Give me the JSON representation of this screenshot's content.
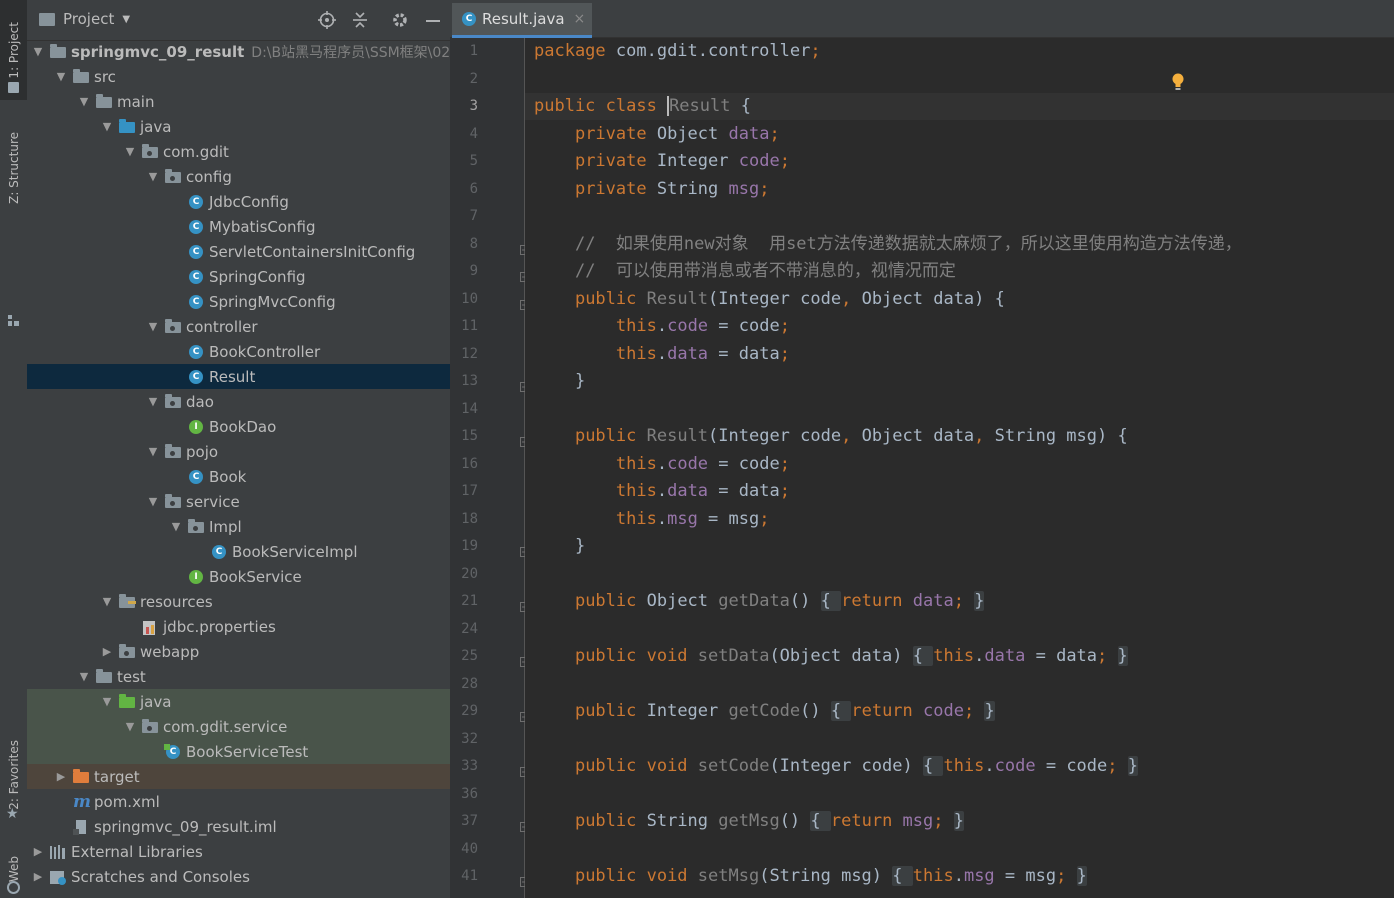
{
  "toolstrip": {
    "project_tab": "1: Project",
    "structure_tab": "Z: Structure",
    "favorites_tab": "2: Favorites",
    "web_tab": "Web"
  },
  "project_panel": {
    "title": "Project",
    "icons": [
      "locate-icon",
      "collapse-all-icon",
      "gear-icon",
      "minimize-icon"
    ],
    "tree": [
      {
        "label": "springmvc_09_result",
        "path": "D:\\B站黑马程序员\\SSM框架\\02",
        "icon": "module-folder",
        "expanded": true,
        "depth": 0,
        "bold": true
      },
      {
        "label": "src",
        "icon": "folder",
        "expanded": true,
        "depth": 1
      },
      {
        "label": "main",
        "icon": "folder",
        "expanded": true,
        "depth": 2
      },
      {
        "label": "java",
        "icon": "source-folder",
        "expanded": true,
        "depth": 3
      },
      {
        "label": "com.gdit",
        "icon": "package",
        "expanded": true,
        "depth": 4
      },
      {
        "label": "config",
        "icon": "package",
        "expanded": true,
        "depth": 5
      },
      {
        "label": "JdbcConfig",
        "icon": "class",
        "depth": 6
      },
      {
        "label": "MybatisConfig",
        "icon": "class",
        "depth": 6
      },
      {
        "label": "ServletContainersInitConfig",
        "icon": "class",
        "depth": 6
      },
      {
        "label": "SpringConfig",
        "icon": "class",
        "depth": 6
      },
      {
        "label": "SpringMvcConfig",
        "icon": "class",
        "depth": 6
      },
      {
        "label": "controller",
        "icon": "package",
        "expanded": true,
        "depth": 5
      },
      {
        "label": "BookController",
        "icon": "class",
        "depth": 6
      },
      {
        "label": "Result",
        "icon": "class",
        "depth": 6,
        "selected": true
      },
      {
        "label": "dao",
        "icon": "package",
        "expanded": true,
        "depth": 5
      },
      {
        "label": "BookDao",
        "icon": "interface",
        "depth": 6
      },
      {
        "label": "pojo",
        "icon": "package",
        "expanded": true,
        "depth": 5
      },
      {
        "label": "Book",
        "icon": "class",
        "depth": 6
      },
      {
        "label": "service",
        "icon": "package",
        "expanded": true,
        "depth": 5
      },
      {
        "label": "Impl",
        "icon": "package",
        "expanded": true,
        "depth": 6
      },
      {
        "label": "BookServiceImpl",
        "icon": "class",
        "depth": 7
      },
      {
        "label": "BookService",
        "icon": "interface",
        "depth": 6
      },
      {
        "label": "resources",
        "icon": "resources-folder",
        "expanded": true,
        "depth": 3
      },
      {
        "label": "jdbc.properties",
        "icon": "properties",
        "depth": 4
      },
      {
        "label": "webapp",
        "icon": "web-folder",
        "expanded": false,
        "depth": 3
      },
      {
        "label": "test",
        "icon": "folder",
        "expanded": true,
        "depth": 2
      },
      {
        "label": "java",
        "icon": "test-folder",
        "expanded": true,
        "depth": 3,
        "highlight": "test"
      },
      {
        "label": "com.gdit.service",
        "icon": "package",
        "expanded": true,
        "depth": 4,
        "highlight": "test"
      },
      {
        "label": "BookServiceTest",
        "icon": "test-class",
        "depth": 5,
        "highlight": "test"
      },
      {
        "label": "target",
        "icon": "excluded-folder",
        "expanded": false,
        "depth": 1,
        "highlight": "target"
      },
      {
        "label": "pom.xml",
        "icon": "maven",
        "depth": 1
      },
      {
        "label": "springmvc_09_result.iml",
        "icon": "iml",
        "depth": 1
      },
      {
        "label": "External Libraries",
        "icon": "libraries",
        "expanded": false,
        "depth": 0
      },
      {
        "label": "Scratches and Consoles",
        "icon": "scratches",
        "expanded": false,
        "depth": 0
      }
    ]
  },
  "editor": {
    "tab_label": "Result.java",
    "close_glyph": "×",
    "current_line": "3",
    "lines": [
      {
        "n": "1",
        "t": [
          [
            "kw",
            "package "
          ],
          [
            "",
            "com.gdit.controller"
          ],
          [
            "kw",
            ";"
          ]
        ]
      },
      {
        "n": "2",
        "t": []
      },
      {
        "n": "3",
        "t": [
          [
            "kw",
            "public class "
          ],
          [
            "caret",
            ""
          ],
          [
            "cmt",
            "Result"
          ],
          [
            "",
            " {"
          ]
        ]
      },
      {
        "n": "4",
        "t": [
          [
            "",
            "    "
          ],
          [
            "kw",
            "private "
          ],
          [
            "",
            "Object "
          ],
          [
            "fld",
            "data"
          ],
          [
            "kw",
            ";"
          ]
        ]
      },
      {
        "n": "5",
        "t": [
          [
            "",
            "    "
          ],
          [
            "kw",
            "private "
          ],
          [
            "",
            "Integer "
          ],
          [
            "fld",
            "code"
          ],
          [
            "kw",
            ";"
          ]
        ]
      },
      {
        "n": "6",
        "t": [
          [
            "",
            "    "
          ],
          [
            "kw",
            "private "
          ],
          [
            "",
            "String "
          ],
          [
            "fld",
            "msg"
          ],
          [
            "kw",
            ";"
          ]
        ]
      },
      {
        "n": "7",
        "t": []
      },
      {
        "n": "8",
        "t": [
          [
            "",
            "    "
          ],
          [
            "cmt",
            "//  如果使用new对象  用set方法传递数据就太麻烦了，所以这里使用构造方法传递，"
          ]
        ]
      },
      {
        "n": "9",
        "t": [
          [
            "",
            "    "
          ],
          [
            "cmt",
            "//  可以使用带消息或者不带消息的，视情况而定"
          ]
        ]
      },
      {
        "n": "10",
        "t": [
          [
            "",
            "    "
          ],
          [
            "kw",
            "public "
          ],
          [
            "cmt",
            "Result"
          ],
          [
            "",
            "(Integer code"
          ],
          [
            "kw",
            ", "
          ],
          [
            "",
            "Object data) {"
          ]
        ]
      },
      {
        "n": "11",
        "t": [
          [
            "",
            "        "
          ],
          [
            "kw",
            "this"
          ],
          [
            "",
            "."
          ],
          [
            "fld",
            "code"
          ],
          [
            "",
            " = code"
          ],
          [
            "kw",
            ";"
          ]
        ]
      },
      {
        "n": "12",
        "t": [
          [
            "",
            "        "
          ],
          [
            "kw",
            "this"
          ],
          [
            "",
            "."
          ],
          [
            "fld",
            "data"
          ],
          [
            "",
            " = data"
          ],
          [
            "kw",
            ";"
          ]
        ]
      },
      {
        "n": "13",
        "t": [
          [
            "",
            "    }"
          ]
        ]
      },
      {
        "n": "14",
        "t": []
      },
      {
        "n": "15",
        "t": [
          [
            "",
            "    "
          ],
          [
            "kw",
            "public "
          ],
          [
            "cmt",
            "Result"
          ],
          [
            "",
            "(Integer code"
          ],
          [
            "kw",
            ", "
          ],
          [
            "",
            "Object data"
          ],
          [
            "kw",
            ", "
          ],
          [
            "",
            "String msg) {"
          ]
        ]
      },
      {
        "n": "16",
        "t": [
          [
            "",
            "        "
          ],
          [
            "kw",
            "this"
          ],
          [
            "",
            "."
          ],
          [
            "fld",
            "code"
          ],
          [
            "",
            " = code"
          ],
          [
            "kw",
            ";"
          ]
        ]
      },
      {
        "n": "17",
        "t": [
          [
            "",
            "        "
          ],
          [
            "kw",
            "this"
          ],
          [
            "",
            "."
          ],
          [
            "fld",
            "data"
          ],
          [
            "",
            " = data"
          ],
          [
            "kw",
            ";"
          ]
        ]
      },
      {
        "n": "18",
        "t": [
          [
            "",
            "        "
          ],
          [
            "kw",
            "this"
          ],
          [
            "",
            "."
          ],
          [
            "fld",
            "msg"
          ],
          [
            "",
            " = msg"
          ],
          [
            "kw",
            ";"
          ]
        ]
      },
      {
        "n": "19",
        "t": [
          [
            "",
            "    }"
          ]
        ]
      },
      {
        "n": "20",
        "t": []
      },
      {
        "n": "21",
        "t": [
          [
            "",
            "    "
          ],
          [
            "kw",
            "public "
          ],
          [
            "",
            "Object "
          ],
          [
            "gray",
            "getData"
          ],
          [
            "",
            "() "
          ],
          [
            "br",
            "{ "
          ],
          [
            "kw",
            "return "
          ],
          [
            "fld",
            "data"
          ],
          [
            "kw",
            "; "
          ],
          [
            "br",
            "}"
          ]
        ]
      },
      {
        "n": "24",
        "t": []
      },
      {
        "n": "25",
        "t": [
          [
            "",
            "    "
          ],
          [
            "kw",
            "public void "
          ],
          [
            "gray",
            "setData"
          ],
          [
            "",
            "(Object data) "
          ],
          [
            "br",
            "{ "
          ],
          [
            "kw",
            "this"
          ],
          [
            "",
            "."
          ],
          [
            "fld",
            "data"
          ],
          [
            "",
            " = data"
          ],
          [
            "kw",
            "; "
          ],
          [
            "br",
            "}"
          ]
        ]
      },
      {
        "n": "28",
        "t": []
      },
      {
        "n": "29",
        "t": [
          [
            "",
            "    "
          ],
          [
            "kw",
            "public "
          ],
          [
            "",
            "Integer "
          ],
          [
            "gray",
            "getCode"
          ],
          [
            "",
            "() "
          ],
          [
            "br",
            "{ "
          ],
          [
            "kw",
            "return "
          ],
          [
            "fld",
            "code"
          ],
          [
            "kw",
            "; "
          ],
          [
            "br",
            "}"
          ]
        ]
      },
      {
        "n": "32",
        "t": []
      },
      {
        "n": "33",
        "t": [
          [
            "",
            "    "
          ],
          [
            "kw",
            "public void "
          ],
          [
            "gray",
            "setCode"
          ],
          [
            "",
            "(Integer code) "
          ],
          [
            "br",
            "{ "
          ],
          [
            "kw",
            "this"
          ],
          [
            "",
            "."
          ],
          [
            "fld",
            "code"
          ],
          [
            "",
            " = code"
          ],
          [
            "kw",
            "; "
          ],
          [
            "br",
            "}"
          ]
        ]
      },
      {
        "n": "36",
        "t": []
      },
      {
        "n": "37",
        "t": [
          [
            "",
            "    "
          ],
          [
            "kw",
            "public "
          ],
          [
            "",
            "String "
          ],
          [
            "gray",
            "getMsg"
          ],
          [
            "",
            "() "
          ],
          [
            "br",
            "{ "
          ],
          [
            "kw",
            "return "
          ],
          [
            "fld",
            "msg"
          ],
          [
            "kw",
            "; "
          ],
          [
            "br",
            "}"
          ]
        ]
      },
      {
        "n": "40",
        "t": []
      },
      {
        "n": "41",
        "t": [
          [
            "",
            "    "
          ],
          [
            "kw",
            "public void "
          ],
          [
            "gray",
            "setMsg"
          ],
          [
            "",
            "(String msg) "
          ],
          [
            "br",
            "{ "
          ],
          [
            "kw",
            "this"
          ],
          [
            "",
            "."
          ],
          [
            "fld",
            "msg"
          ],
          [
            "",
            " = msg"
          ],
          [
            "kw",
            "; "
          ],
          [
            "br",
            "}"
          ]
        ]
      }
    ],
    "fold_lines": [
      "8",
      "9",
      "10",
      "13",
      "15",
      "19",
      "21",
      "25",
      "29",
      "33",
      "37",
      "41"
    ]
  },
  "colors": {
    "keyword": "#cc7832",
    "field": "#9876aa",
    "comment": "#808080",
    "text": "#a9b7c6",
    "selection": "#0d293e",
    "class_icon": "#3592c4",
    "interface_icon": "#62b543",
    "folder": "#87939a",
    "source_folder": "#3592c4",
    "test_folder": "#62b543",
    "excluded_folder": "#e07d3c",
    "intention_bulb": "#f4af3d"
  }
}
